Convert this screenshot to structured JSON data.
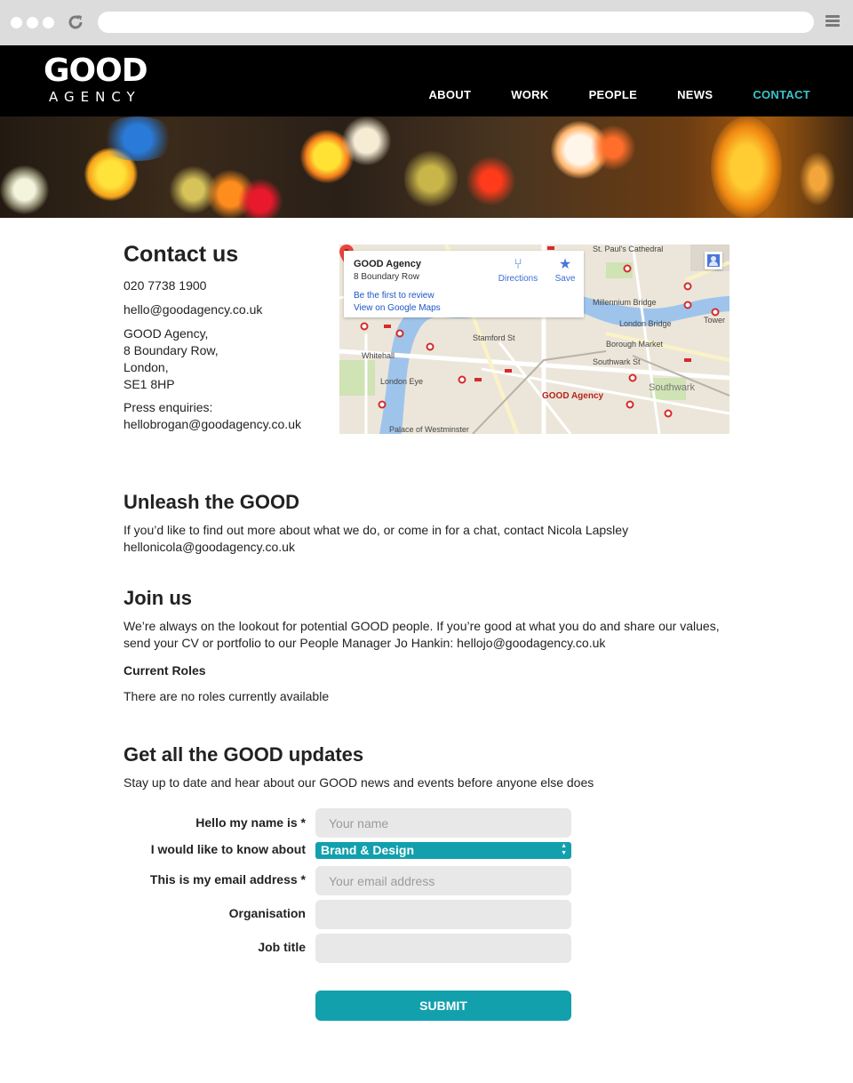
{
  "brand": {
    "logo_main": "GOOD",
    "logo_sub": "AGENCY"
  },
  "nav": [
    {
      "label": "ABOUT",
      "active": false
    },
    {
      "label": "WORK",
      "active": false
    },
    {
      "label": "PEOPLE",
      "active": false
    },
    {
      "label": "NEWS",
      "active": false
    },
    {
      "label": "CONTACT",
      "active": true
    }
  ],
  "colors": {
    "accent": "#12a0ad",
    "nav_active": "#3cc3c9",
    "header_bg": "#000000"
  },
  "contact": {
    "title": "Contact us",
    "phone": "020 7738 1900",
    "email": "hello@goodagency.co.uk",
    "address": [
      "GOOD Agency,",
      "8 Boundary Row,",
      "London,",
      "SE1 8HP"
    ],
    "press_label": "Press enquiries:",
    "press_email": "hellobrogan@goodagency.co.uk"
  },
  "map": {
    "place_name": "GOOD Agency",
    "place_address": "8 Boundary Row",
    "review_link": "Be the first to review",
    "maps_link": "View on Google Maps",
    "directions_label": "Directions",
    "save_label": "Save",
    "pin_label": "GOOD Agency",
    "labels": {
      "st_pauls": "St. Paul's Cathedral",
      "millennium": "Millennium Bridge",
      "london_bridge": "London Bridge",
      "borough_market": "Borough Market",
      "southwark_st": "Southwark St",
      "southwark": "Southwark",
      "london_eye": "London Eye",
      "palace": "Palace of Westminster",
      "stamford": "Stamford St",
      "whitehall": "Whitehall",
      "tower": "Tower"
    }
  },
  "unleash": {
    "title": "Unleash the GOOD",
    "line1": "If you’d like to find out more about what we do, or come in for a chat, contact Nicola Lapsley",
    "line2": "hellonicola@goodagency.co.uk"
  },
  "join": {
    "title": "Join us",
    "line1": "We’re always on the lookout for potential GOOD people. If you’re good at what you do and share our values,",
    "line2": "send your CV or portfolio to our People Manager Jo Hankin: hellojo@goodagency.co.uk",
    "roles_title": "Current Roles",
    "roles_text": "There are no roles currently available"
  },
  "updates": {
    "title": "Get all the GOOD updates",
    "intro": "Stay up to date and hear about our GOOD news and events before anyone else does",
    "form": {
      "name_label": "Hello my name is *",
      "name_placeholder": "Your name",
      "topic_label": "I would like to know about",
      "topic_value": "Brand & Design",
      "email_label": "This is my email address *",
      "email_placeholder": "Your email address",
      "org_label": "Organisation",
      "job_label": "Job title",
      "submit_label": "SUBMIT"
    }
  }
}
